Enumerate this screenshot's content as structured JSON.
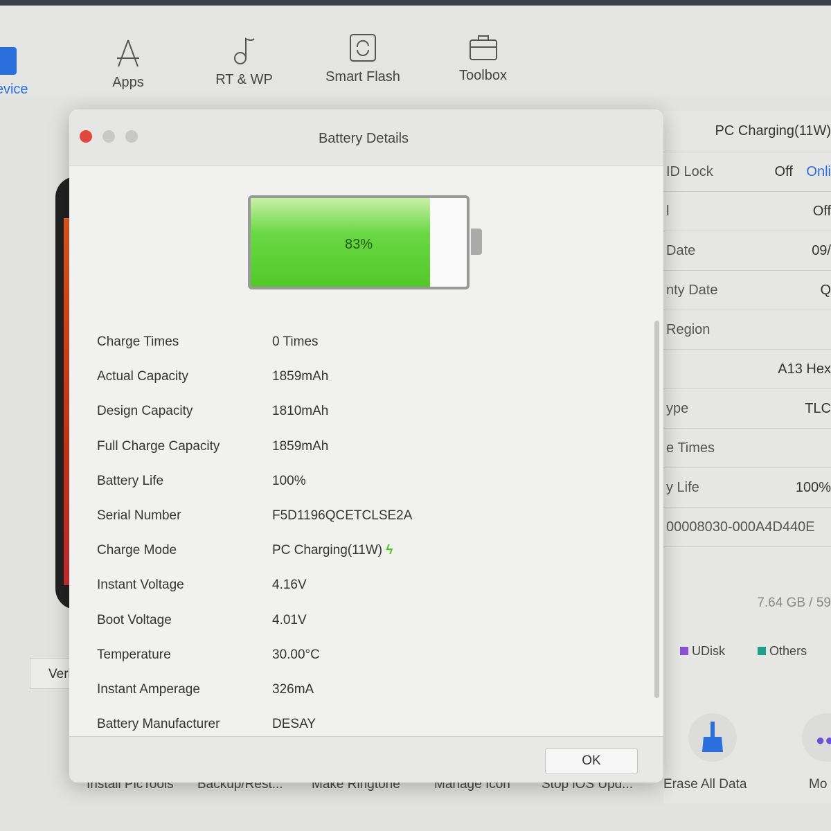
{
  "toolbar": {
    "items": [
      {
        "label": "Device",
        "icon": "tablet-icon"
      },
      {
        "label": "Apps",
        "icon": "app-store-icon"
      },
      {
        "label": "RT & WP",
        "icon": "music-note-icon"
      },
      {
        "label": "Smart Flash",
        "icon": "refresh-icon"
      },
      {
        "label": "Toolbox",
        "icon": "toolbox-icon"
      }
    ]
  },
  "right_panel": {
    "charge_mode": "PC Charging(11W)",
    "rows": [
      {
        "label": "ID Lock",
        "value": "Off",
        "link": "Onli"
      },
      {
        "label": "l",
        "value": "Off"
      },
      {
        "label": "Date",
        "value": "09/"
      },
      {
        "label": "nty Date",
        "value": "Q"
      },
      {
        "label": "Region",
        "value": ""
      },
      {
        "label": "",
        "value": "A13 Hex"
      },
      {
        "label": "ype",
        "value": "TLC"
      },
      {
        "label": "e Times",
        "value": ""
      },
      {
        "label": "y Life",
        "value": "100%"
      },
      {
        "label": "00008030-000A4D440E",
        "value": ""
      }
    ],
    "storage": "7.64 GB / 59",
    "legend": [
      {
        "label": "UDisk",
        "color": "#8b4fd8"
      },
      {
        "label": "Others",
        "color": "#1fa08a"
      }
    ]
  },
  "left": {
    "verify_label": "Verifi"
  },
  "bottom_tools": [
    "Install PicTools",
    "Backup/Rest...",
    "Make Ringtone",
    "Manage Icon",
    "Stop iOS Upd...",
    "Erase All Data",
    "Mo"
  ],
  "dialog": {
    "title": "Battery Details",
    "battery_percent": 83,
    "battery_label": "83%",
    "ok_label": "OK",
    "charging_icon": "lightning-icon",
    "accent": "#4ec82a",
    "rows": [
      {
        "label": "Charge Times",
        "value": "0 Times"
      },
      {
        "label": "Actual Capacity",
        "value": "1859mAh"
      },
      {
        "label": "Design Capacity",
        "value": "1810mAh"
      },
      {
        "label": "Full Charge Capacity",
        "value": "1859mAh"
      },
      {
        "label": "Battery Life",
        "value": "100%"
      },
      {
        "label": "Serial Number",
        "value": "F5D1196QCETCLSE2A"
      },
      {
        "label": "Charge Mode",
        "value": "PC Charging(11W)"
      },
      {
        "label": "Instant Voltage",
        "value": "4.16V"
      },
      {
        "label": "Boot Voltage",
        "value": "4.01V"
      },
      {
        "label": "Temperature",
        "value": "30.00°C"
      },
      {
        "label": "Instant Amperage",
        "value": "326mA"
      },
      {
        "label": "Battery Manufacturer",
        "value": "DESAY"
      }
    ]
  }
}
